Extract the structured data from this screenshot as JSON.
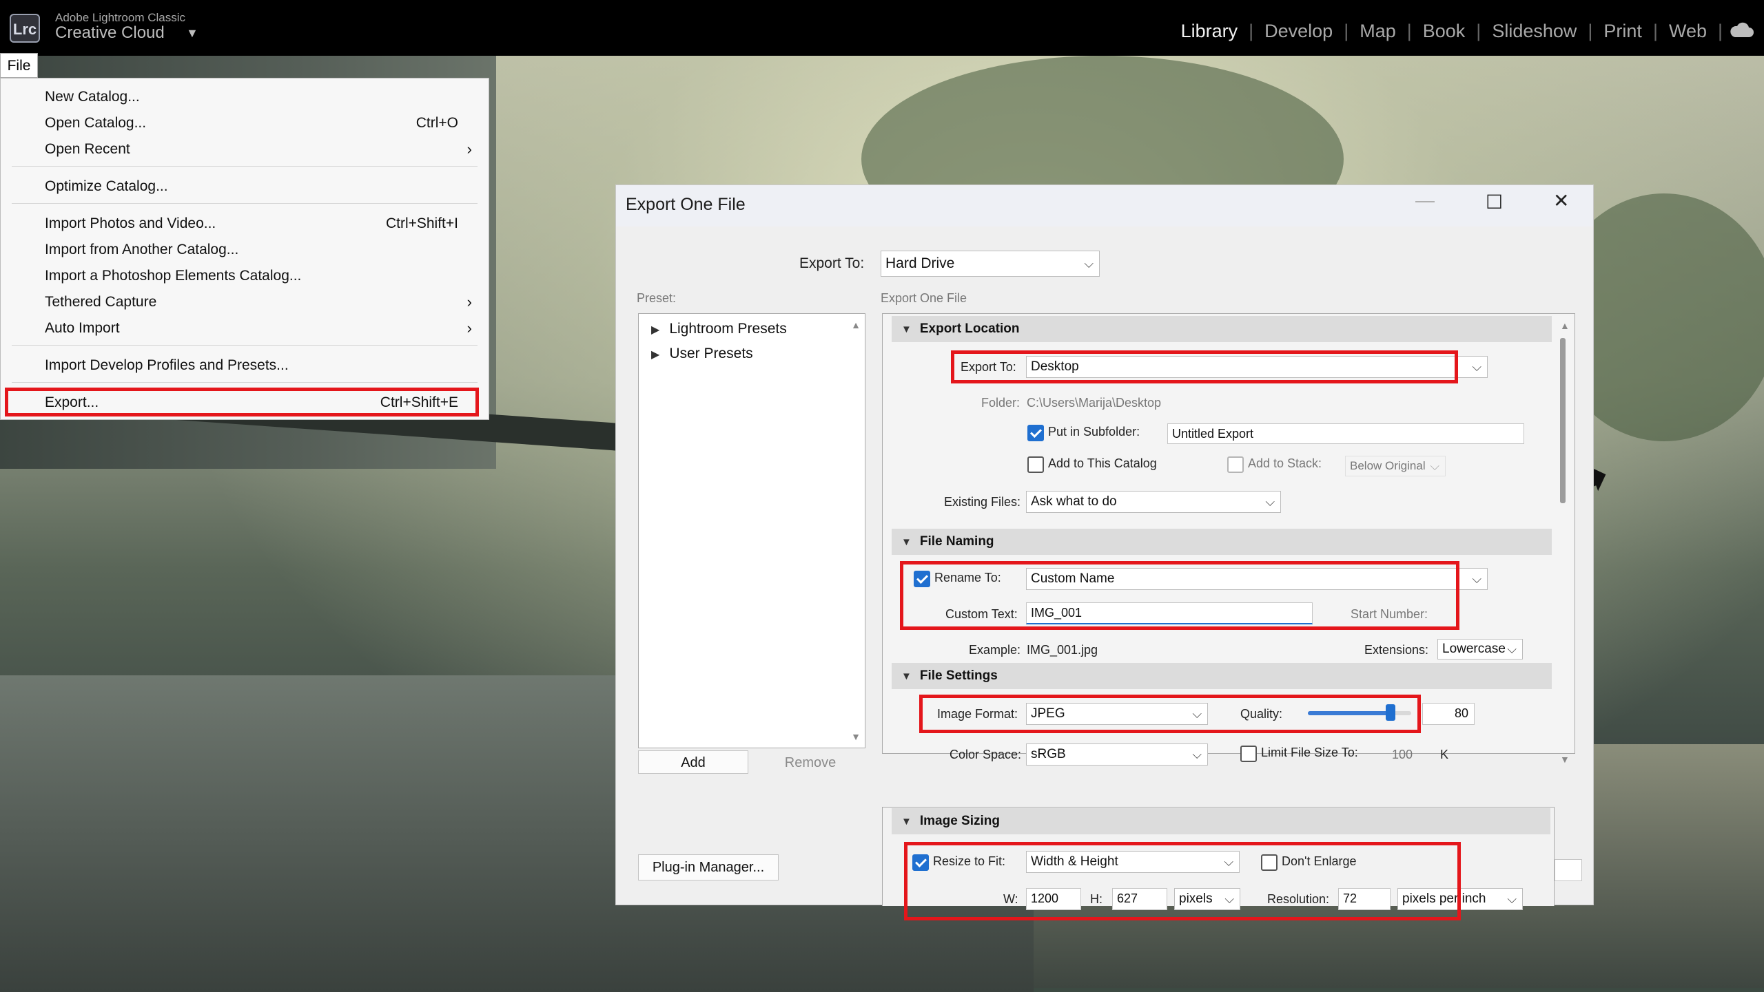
{
  "app": {
    "brand_small": "Adobe Lightroom Classic",
    "brand_big": "Creative Cloud",
    "logo": "Lrc",
    "modules": [
      "Library",
      "Develop",
      "Map",
      "Book",
      "Slideshow",
      "Print",
      "Web"
    ],
    "active_module": "Library"
  },
  "menu": {
    "tab": "File",
    "items": [
      {
        "label": "New Catalog...",
        "shortcut": ""
      },
      {
        "label": "Open Catalog...",
        "shortcut": "Ctrl+O"
      },
      {
        "label": "Open Recent",
        "shortcut": ""
      },
      {
        "label": "Optimize Catalog...",
        "shortcut": ""
      },
      {
        "label": "Import Photos and Video...",
        "shortcut": "Ctrl+Shift+I"
      },
      {
        "label": "Import from Another Catalog...",
        "shortcut": ""
      },
      {
        "label": "Import a Photoshop Elements Catalog...",
        "shortcut": ""
      },
      {
        "label": "Tethered Capture",
        "shortcut": ""
      },
      {
        "label": "Auto Import",
        "shortcut": ""
      },
      {
        "label": "Import Develop Profiles and Presets...",
        "shortcut": ""
      },
      {
        "label": "Export...",
        "shortcut": "Ctrl+Shift+E"
      }
    ]
  },
  "dialog": {
    "title": "Export One File",
    "export_to_label": "Export To:",
    "export_to_value": "Hard Drive",
    "preset_label": "Preset:",
    "panel_label": "Export One File",
    "presets": [
      "Lightroom Presets",
      "User Presets"
    ],
    "add_button": "Add",
    "remove_button": "Remove",
    "plugin_manager": "Plug-in Manager...",
    "export_location": {
      "header": "Export Location",
      "export_to_label": "Export To:",
      "export_to_value": "Desktop",
      "folder_label": "Folder:",
      "folder_value": "C:\\Users\\Marija\\Desktop",
      "subfolder_label": "Put in Subfolder:",
      "subfolder_value": "Untitled Export",
      "add_catalog_label": "Add to This Catalog",
      "add_stack_label": "Add to Stack:",
      "stack_value": "Below Original",
      "existing_label": "Existing Files:",
      "existing_value": "Ask what to do"
    },
    "file_naming": {
      "header": "File Naming",
      "rename_label": "Rename To:",
      "rename_value": "Custom Name",
      "custom_text_label": "Custom Text:",
      "custom_text_value": "IMG_001",
      "start_number_label": "Start Number:",
      "example_label": "Example:",
      "example_value": "IMG_001.jpg",
      "extensions_label": "Extensions:",
      "extensions_value": "Lowercase"
    },
    "file_settings": {
      "header": "File Settings",
      "format_label": "Image Format:",
      "format_value": "JPEG",
      "quality_label": "Quality:",
      "quality_value": "80",
      "quality_fraction": 0.8,
      "color_space_label": "Color Space:",
      "color_space_value": "sRGB",
      "limit_label": "Limit File Size To:",
      "limit_value": "100",
      "limit_unit": "K"
    },
    "image_sizing": {
      "header": "Image Sizing",
      "resize_label": "Resize to Fit:",
      "resize_value": "Width & Height",
      "dont_enlarge_label": "Don't Enlarge",
      "w_label": "W:",
      "w_value": "1200",
      "h_label": "H:",
      "h_value": "627",
      "unit_value": "pixels",
      "resolution_label": "Resolution:",
      "resolution_value": "72",
      "resolution_unit": "pixels per inch"
    }
  },
  "colors": {
    "highlight": "#e4161b",
    "accent": "#1f6fd0"
  }
}
